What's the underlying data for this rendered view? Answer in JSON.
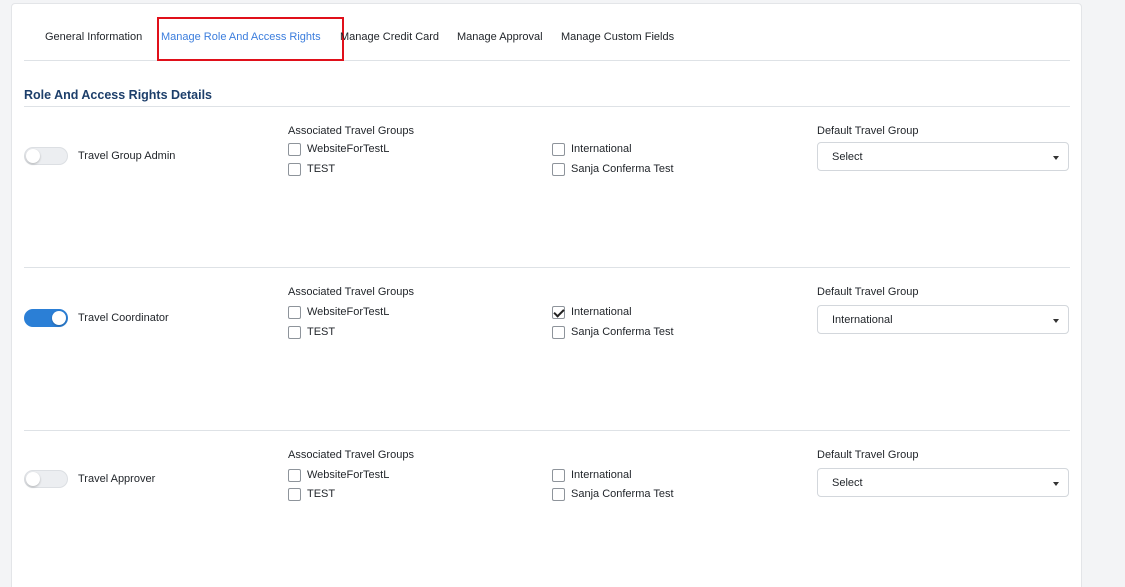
{
  "tabs": [
    {
      "label": "General Information",
      "active": false
    },
    {
      "label": "Manage Role And Access Rights",
      "active": true
    },
    {
      "label": "Manage Credit Card",
      "active": false
    },
    {
      "label": "Manage Approval",
      "active": false
    },
    {
      "label": "Manage Custom Fields",
      "active": false
    }
  ],
  "section_title": "Role And Access Rights Details",
  "colors": {
    "accent": "#2b7fd6",
    "active_tab": "#3b7ddd",
    "highlight": "#e0101a",
    "title": "#1d3f6b"
  },
  "roles": [
    {
      "name": "Travel Group Admin",
      "enabled": false,
      "groups_label": "Associated Travel Groups",
      "groups": [
        {
          "label": "WebsiteForTestL",
          "checked": false
        },
        {
          "label": "TEST",
          "checked": false
        },
        {
          "label": "International",
          "checked": false
        },
        {
          "label": "Sanja Conferma Test",
          "checked": false
        }
      ],
      "default_label": "Default Travel Group",
      "default_value": "Select"
    },
    {
      "name": "Travel Coordinator",
      "enabled": true,
      "groups_label": "Associated Travel Groups",
      "groups": [
        {
          "label": "WebsiteForTestL",
          "checked": false
        },
        {
          "label": "TEST",
          "checked": false
        },
        {
          "label": "International",
          "checked": true
        },
        {
          "label": "Sanja Conferma Test",
          "checked": false
        }
      ],
      "default_label": "Default Travel Group",
      "default_value": "International"
    },
    {
      "name": "Travel Approver",
      "enabled": false,
      "groups_label": "Associated Travel Groups",
      "groups": [
        {
          "label": "WebsiteForTestL",
          "checked": false
        },
        {
          "label": "TEST",
          "checked": false
        },
        {
          "label": "International",
          "checked": false
        },
        {
          "label": "Sanja Conferma Test",
          "checked": false
        }
      ],
      "default_label": "Default Travel Group",
      "default_value": "Select"
    }
  ]
}
